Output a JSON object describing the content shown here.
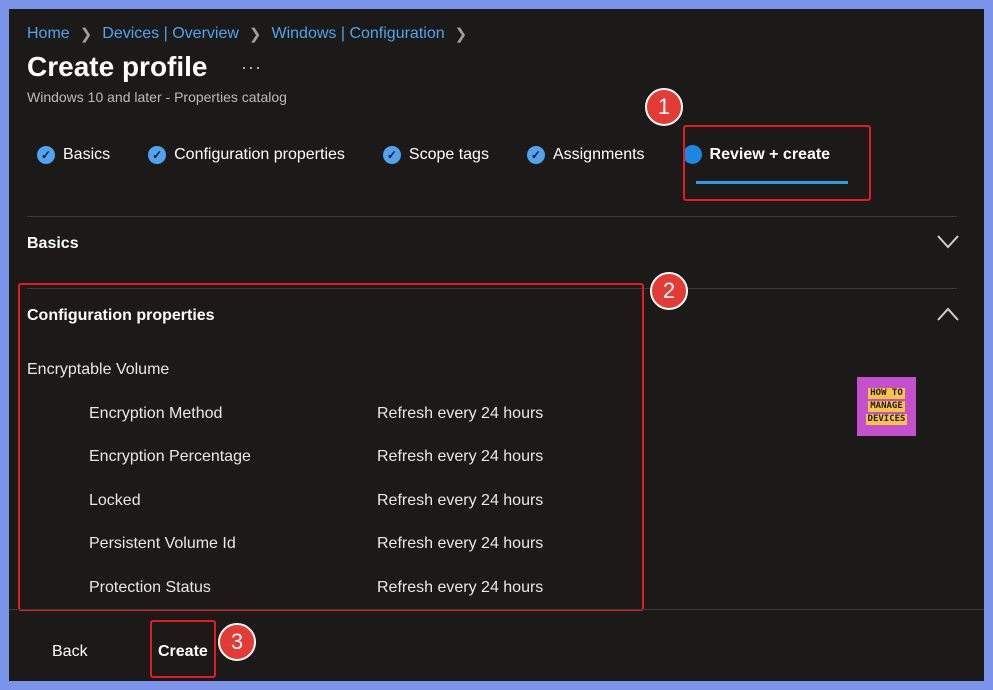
{
  "breadcrumb": [
    "Home",
    "Devices | Overview",
    "Windows | Configuration"
  ],
  "page": {
    "title": "Create profile",
    "more": "···",
    "subtitle": "Windows 10 and later - Properties catalog"
  },
  "tabs": [
    {
      "label": "Basics",
      "state": "complete"
    },
    {
      "label": "Configuration properties",
      "state": "complete"
    },
    {
      "label": "Scope tags",
      "state": "complete"
    },
    {
      "label": "Assignments",
      "state": "complete"
    },
    {
      "label": "Review + create",
      "state": "active"
    }
  ],
  "sections": {
    "basics": {
      "title": "Basics",
      "expanded": false
    },
    "config": {
      "title": "Configuration properties",
      "expanded": true,
      "group": "Encryptable Volume",
      "rows": [
        {
          "name": "Encryption Method",
          "value": "Refresh every 24 hours"
        },
        {
          "name": "Encryption Percentage",
          "value": "Refresh every 24 hours"
        },
        {
          "name": "Locked",
          "value": "Refresh every 24 hours"
        },
        {
          "name": "Persistent Volume Id",
          "value": "Refresh every 24 hours"
        },
        {
          "name": "Protection Status",
          "value": "Refresh every 24 hours"
        }
      ]
    }
  },
  "logo": {
    "line1": "HOW TO",
    "line2": "MANAGE",
    "line3": "DEVICES"
  },
  "footer": {
    "back": "Back",
    "create": "Create"
  },
  "annotations": {
    "one": "1",
    "two": "2",
    "three": "3"
  },
  "colors": {
    "accent": "#1a86e5",
    "highlight": "#e81b23",
    "background": "#1b1a19",
    "border": "#7b93e8"
  }
}
